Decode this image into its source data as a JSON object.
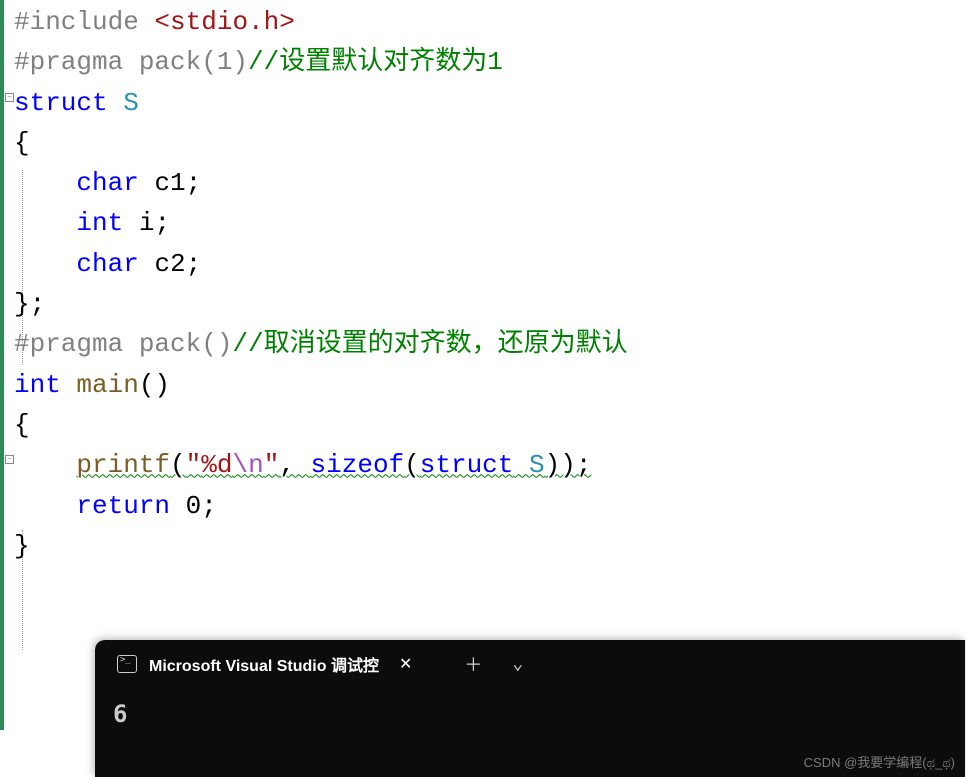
{
  "code": {
    "include_directive": "#include",
    "include_header_open": " <",
    "include_header": "stdio.h",
    "include_header_close": ">",
    "pragma1_pre": "#pragma",
    "pragma1_rest": " pack(1)",
    "pragma1_comment": "//设置默认对齐数为1",
    "struct_kw": "struct",
    "struct_name": " S",
    "brace_open": "{",
    "field1_type": "char",
    "field1_name": " c1;",
    "field2_type": "int",
    "field2_name": " i;",
    "field3_type": "char",
    "field3_name": " c2;",
    "brace_close": "};",
    "pragma2_pre": "#pragma",
    "pragma2_rest": " pack()",
    "pragma2_comment": "//取消设置的对齐数，还原为默认",
    "main_type": "int",
    "main_name": " main",
    "main_paren": "()",
    "main_open": "{",
    "printf_name": "printf",
    "printf_open": "(",
    "printf_str_open": "\"",
    "printf_str_fmt": "%d",
    "printf_escape": "\\n",
    "printf_str_close": "\"",
    "printf_comma": ", ",
    "sizeof_kw": "sizeof",
    "sizeof_open": "(",
    "sizeof_struct": "struct",
    "sizeof_type": " S",
    "sizeof_close": "));",
    "return_kw": "return",
    "return_val": " 0;",
    "main_close": "}",
    "indent4": "    ",
    "space1": " "
  },
  "terminal": {
    "tab_title": "Microsoft Visual Studio 调试控",
    "output": "6"
  },
  "watermark": "CSDN @我要学编程(ಥ_ಥ)"
}
